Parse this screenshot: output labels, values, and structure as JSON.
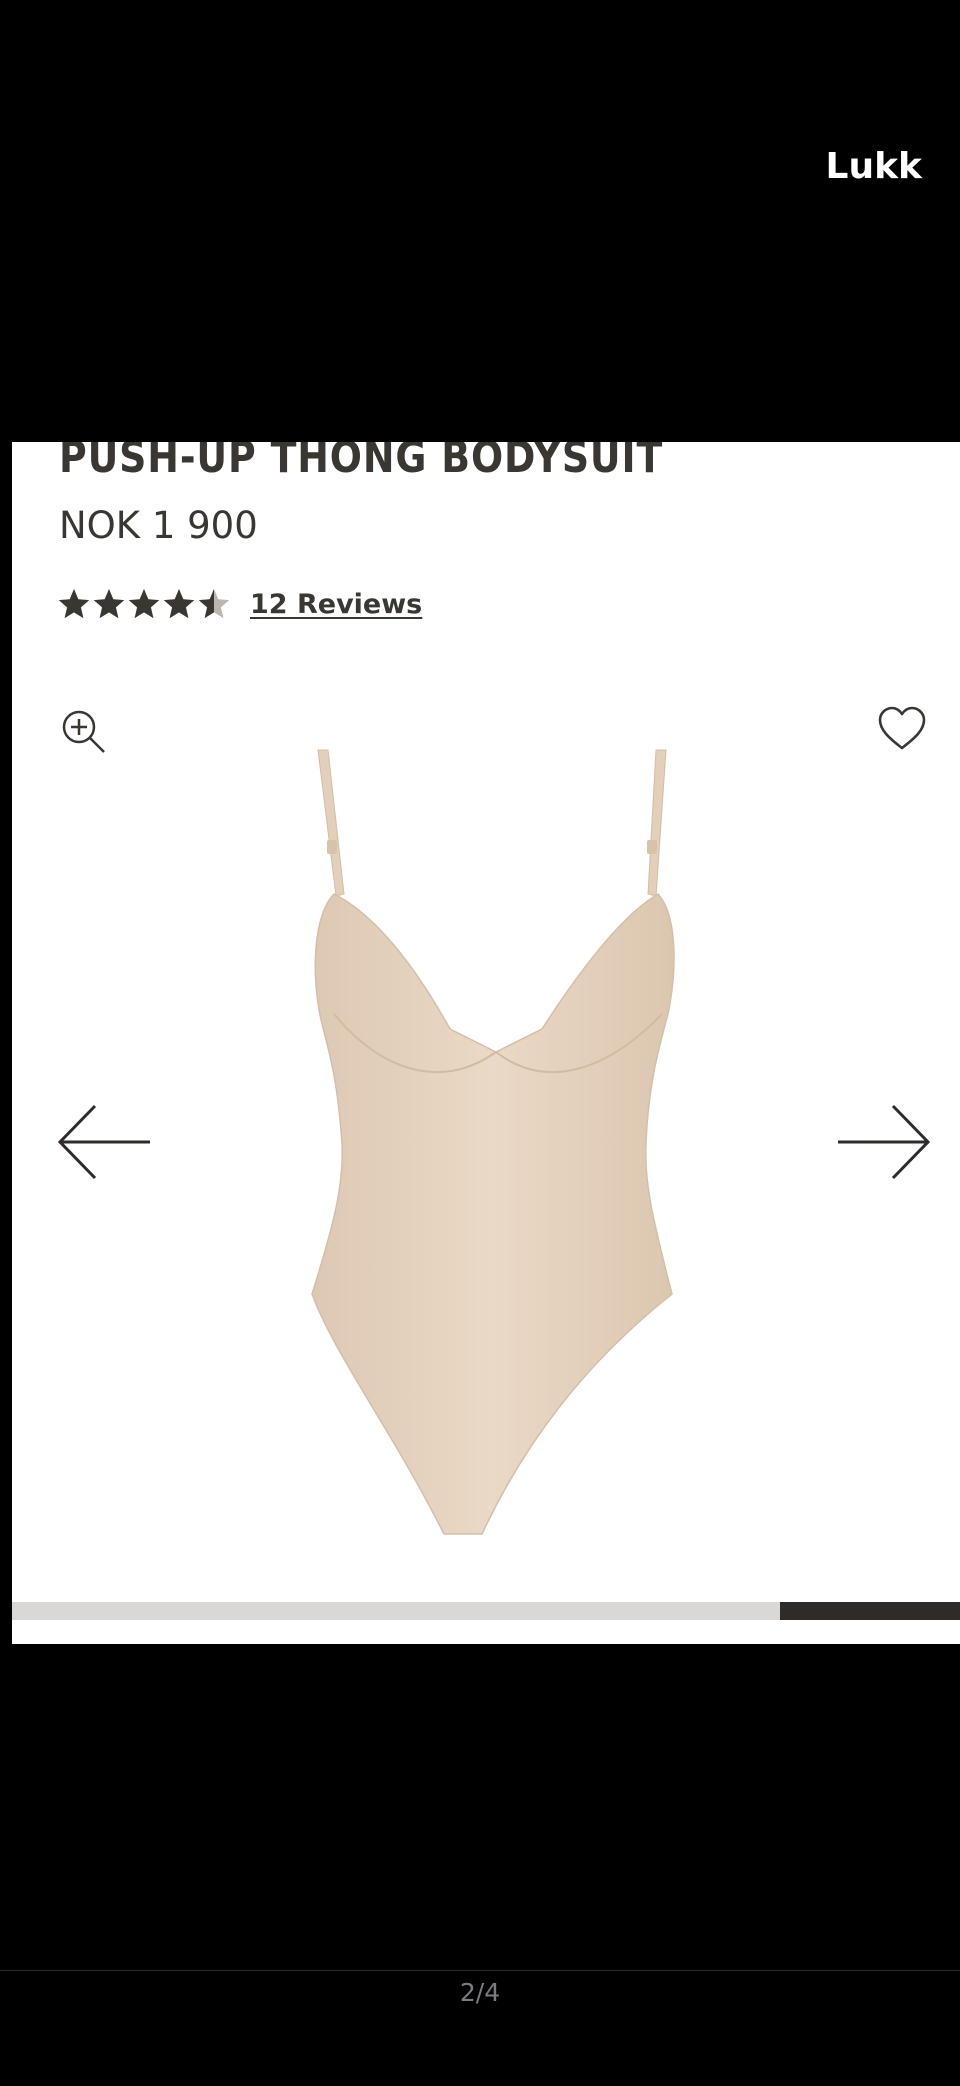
{
  "viewer": {
    "close_label": "Lukk",
    "pager_text": "2/4"
  },
  "product": {
    "title": "PUSH-UP THONG BODYSUIT",
    "price": "NOK 1 900",
    "rating": 4.5,
    "rating_max": 5,
    "reviews_label": "12 Reviews"
  },
  "gallery": {
    "image_progress": 0.19,
    "icons": {
      "zoom": "zoom-in-icon",
      "wishlist": "heart-icon",
      "prev": "arrow-left-icon",
      "next": "arrow-right-icon",
      "star": "star-icon"
    }
  },
  "colors": {
    "text": "#3a3632",
    "product": "#e6d4c0",
    "progress_track": "#d9d8d7",
    "progress_fill": "#2e2b28"
  }
}
